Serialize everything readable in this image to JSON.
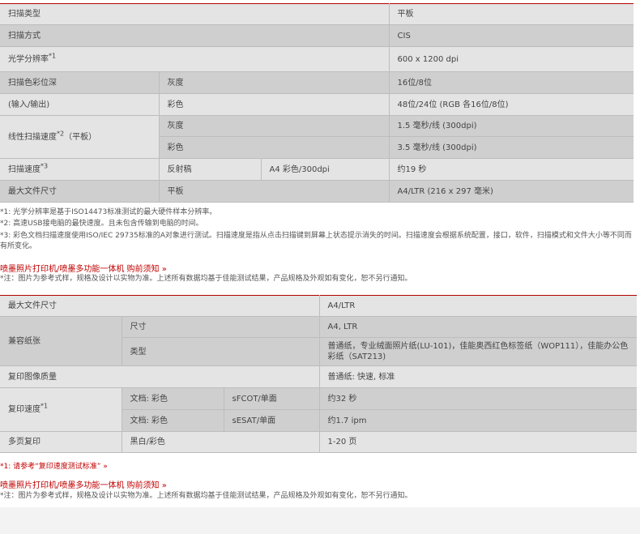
{
  "table1": {
    "rows": [
      {
        "label": "扫描类型",
        "value": "平板"
      },
      {
        "label": "扫描方式",
        "value": "CIS"
      },
      {
        "label": "光学分辨率",
        "label_note": "*1",
        "value": "600 x 1200 dpi"
      },
      {
        "label": "扫描色彩位深",
        "sub": "灰度",
        "value": "16位/8位"
      },
      {
        "label": "(输入/输出)",
        "sub": "彩色",
        "value": "48位/24位 (RGB 各16位/8位)"
      },
      {
        "label": "线性扫描速度",
        "label_note": "*2",
        "label_suffix": "（平板）",
        "sub1": "灰度",
        "value1": "1.5 毫秒/线 (300dpi)",
        "sub2": "彩色",
        "value2": "3.5 毫秒/线 (300dpi)"
      },
      {
        "label": "扫描速度",
        "label_note": "*3",
        "sub": "反射稿",
        "sub2": "A4 彩色/300dpi",
        "value": "约19 秒"
      },
      {
        "label": "最大文件尺寸",
        "sub": "平板",
        "value": "A4/LTR (216 x 297 毫米)"
      }
    ]
  },
  "notes1": [
    "*1: 光学分辨率是基于ISO14473标准测试的最大硬件样本分辨率。",
    "*2: 高速USB接电脑的最快速度。且未包含传输到电脑的时间。",
    "*3: 彩色文档扫描速度使用ISO/IEC 29735标准的A对象进行测试。扫描速度是指从点击扫描键到屏幕上状态提示消失的时间。扫描速度会根据系统配置，接口，软件，扫描模式和文件大小等不同而有所变化。"
  ],
  "link1": "喷墨照片打印机/喷墨多功能一体机 购前须知 »",
  "disclaimer1": "*注：图片为参考式样，规格及设计以实物为准。上述所有数据均基于佳能测试结果，产品规格及外观如有变化，恕不另行通知。",
  "table2": {
    "max_size": {
      "label": "最大文件尺寸",
      "value": "A4/LTR"
    },
    "paper": {
      "label": "兼容纸张",
      "size_label": "尺寸",
      "size_value": "A4, LTR",
      "type_label": "类型",
      "type_value": "普通纸，专业绒面照片纸(LU-101)，佳能奥西红色标签纸（WOP111），佳能办公色彩纸（SAT213)"
    },
    "quality": {
      "label": "复印图像质量",
      "value": "普通纸: 快速, 标准"
    },
    "speed": {
      "label": "复印速度",
      "label_note": "*1",
      "row1_a": "文档: 彩色",
      "row1_b": "sFCOT/单面",
      "row1_value": "约32 秒",
      "row2_a": "文档: 彩色",
      "row2_b": "sESAT/单面",
      "row2_value": "约1.7 ipm"
    },
    "multi": {
      "label": "多页复印",
      "sub": "黑白/彩色",
      "value": "1-20 页"
    }
  },
  "note2": "*1: 请参考“复印速度测试标准” »",
  "link2": "喷墨照片打印机/喷墨多功能一体机 购前须知 »",
  "disclaimer2": "*注：图片为参考式样，规格及设计以实物为准。上述所有数据均基于佳能测试结果，产品规格及外观如有变化，恕不另行通知。",
  "colors": {
    "accent": "#c00000",
    "row_light": "#e4e4e4",
    "row_dark": "#cfcfcf"
  }
}
